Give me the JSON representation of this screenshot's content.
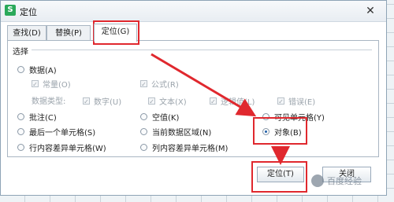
{
  "window": {
    "title": "定位",
    "close_glyph": "✕",
    "app_icon": "S"
  },
  "tabs": [
    {
      "label": "查找(D)"
    },
    {
      "label": "替换(P)"
    },
    {
      "label": "定位(G)",
      "active": true
    }
  ],
  "group_label": "选择",
  "options": {
    "data": "数据(A)",
    "constant": "常量(O)",
    "formula": "公式(R)",
    "data_type_label": "数据类型:",
    "number": "数字(U)",
    "text": "文本(X)",
    "logical": "逻辑值(L)",
    "error": "错误(E)",
    "comment": "批注(C)",
    "blank": "空值(K)",
    "visible": "可见单元格(Y)",
    "last_cell": "最后一个单元格(S)",
    "current_region": "当前数据区域(N)",
    "objects": "对象(B)",
    "row_diff": "行内容差异单元格(W)",
    "col_diff": "列内容差异单元格(M)"
  },
  "selected_option": "对象(B)",
  "buttons": {
    "goto": "定位(T)",
    "close": "关闭"
  },
  "annotation_color": "#e0282e",
  "watermark": "百度经验",
  "icons": [
    "app-icon",
    "close-icon",
    "paw-icon"
  ]
}
